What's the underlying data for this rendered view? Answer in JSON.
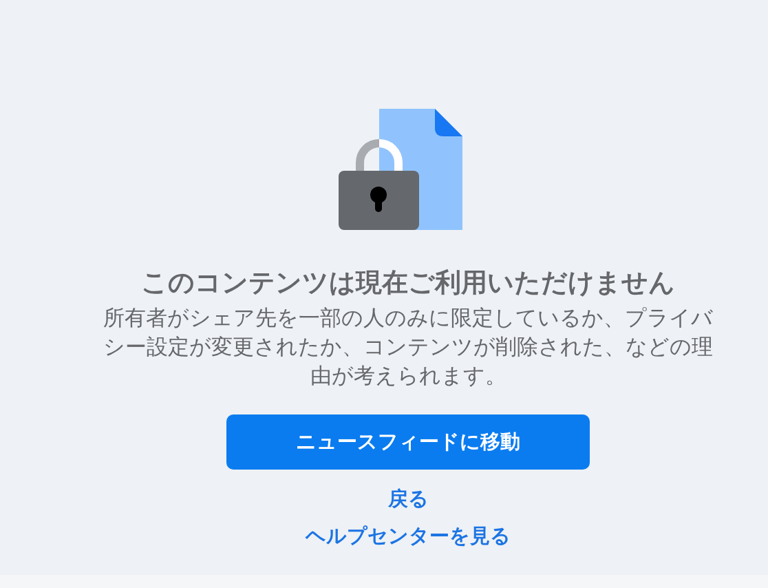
{
  "title": "このコンテンツは現在ご利用いただけません",
  "message": "所有者がシェア先を一部の人のみに限定しているか、プライバシー設定が変更されたか、コンテンツが削除された、などの理由が考えられます。",
  "primary_button": {
    "label": "ニュースフィードに移動"
  },
  "links": [
    {
      "label": "戻る"
    },
    {
      "label": "ヘルプセンターを見る"
    }
  ]
}
